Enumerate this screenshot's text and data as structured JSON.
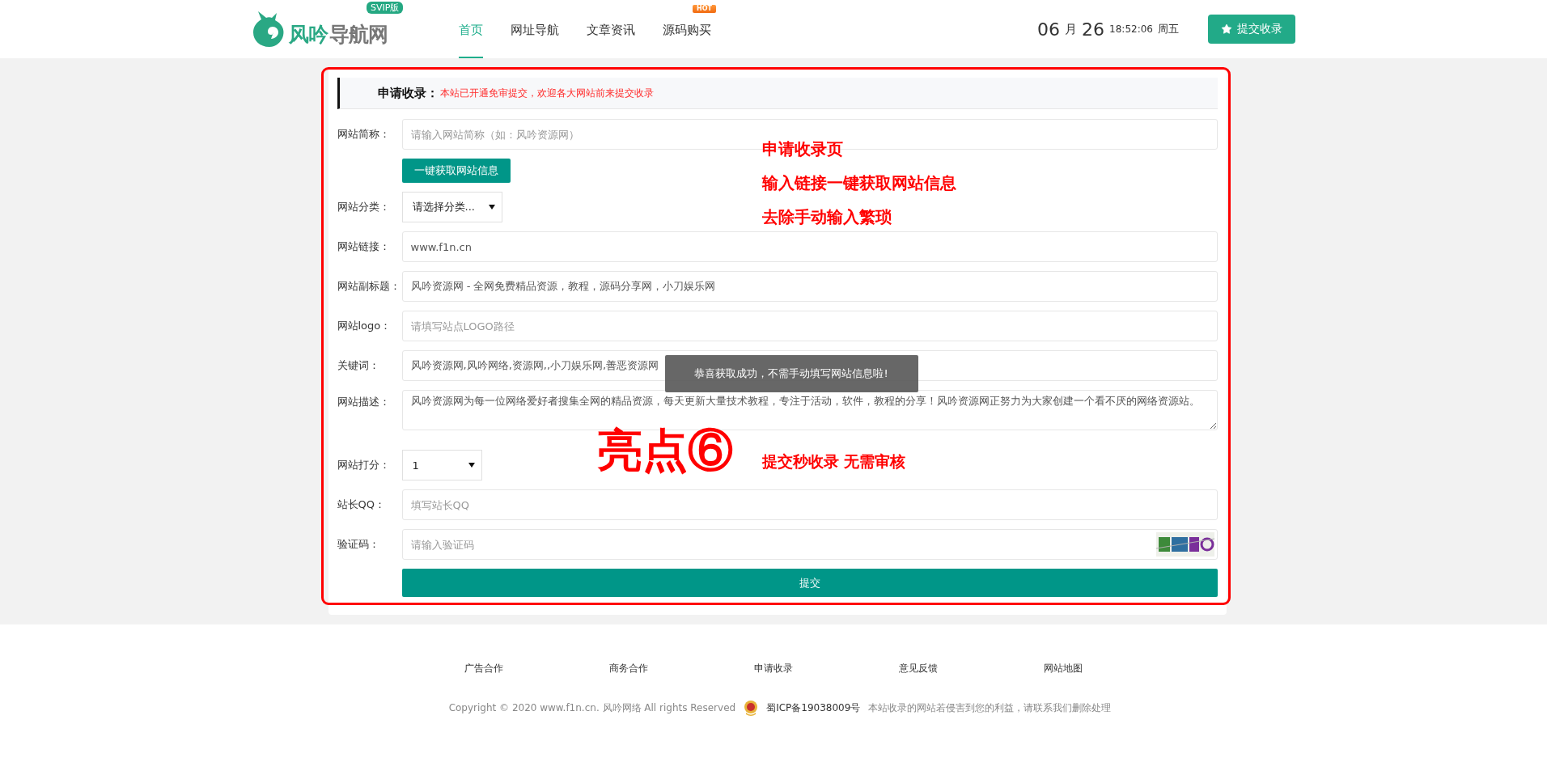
{
  "header": {
    "logo": {
      "name_1": "风吟",
      "name_2": "导航网",
      "badge": "SVIP版"
    },
    "nav": [
      {
        "label": "首页",
        "selected": true
      },
      {
        "label": "网址导航",
        "selected": false
      },
      {
        "label": "文章资讯",
        "selected": false
      },
      {
        "label": "源码购买",
        "selected": false,
        "badge": "HOT"
      }
    ],
    "date": {
      "month": "06",
      "month_unit": "月",
      "day": "26",
      "time": "18:52:06",
      "weekday": "周五"
    },
    "submit_button": "提交收录"
  },
  "form": {
    "title": "申请收录：",
    "notice": "本站已开通免审提交，欢迎各大网站前来提交收录",
    "fields": [
      {
        "kind": "input",
        "label": "网站简称：",
        "placeholder": "请输入网站简称（如：风吟资源网）"
      },
      {
        "kind": "button",
        "label": "一键获取网站信息"
      },
      {
        "kind": "select",
        "label": "网站分类：",
        "value": "请选择分类..."
      },
      {
        "kind": "input",
        "label": "网站链接：",
        "value": "www.f1n.cn"
      },
      {
        "kind": "input",
        "label": "网站副标题：",
        "value": "风吟资源网 - 全网免费精品资源，教程，源码分享网，小刀娱乐网"
      },
      {
        "kind": "input",
        "label": "网站logo：",
        "placeholder": "请填写站点LOGO路径"
      },
      {
        "kind": "input",
        "label": "关键词：",
        "value": "风吟资源网,风吟网络,资源网,,小刀娱乐网,善恶资源网"
      },
      {
        "kind": "textarea",
        "label": "网站描述：",
        "value": "风吟资源网为每一位网络爱好者搜集全网的精品资源，每天更新大量技术教程，专注于活动，软件，教程的分享！风吟资源网正努力为大家创建一个看不厌的网络资源站。"
      },
      {
        "kind": "select",
        "label": "网站打分：",
        "value": "1"
      },
      {
        "kind": "input",
        "label": "站长QQ：",
        "placeholder": "填写站长QQ"
      },
      {
        "kind": "captcha",
        "label": "验证码：",
        "placeholder": "请输入验证码"
      }
    ],
    "submit": "提交",
    "toast": "恭喜获取成功，不需手动填写网站信息啦!",
    "annotations": {
      "lines": [
        "申请收录页",
        "输入链接一键获取网站信息",
        "去除手动输入繁琐"
      ],
      "highlight": "亮点⑥",
      "highlight_note": "提交秒收录 无需审核"
    }
  },
  "footer": {
    "links": [
      "广告合作",
      "商务合作",
      "申请收录",
      "意见反馈",
      "网站地图"
    ],
    "copyright": "Copyright © 2020 www.f1n.cn. 风吟网络 All rights Reserved",
    "icp": "蜀ICP备19038009号",
    "disclaimer": "本站收录的网站若侵害到您的利益，请联系我们删除处理"
  }
}
